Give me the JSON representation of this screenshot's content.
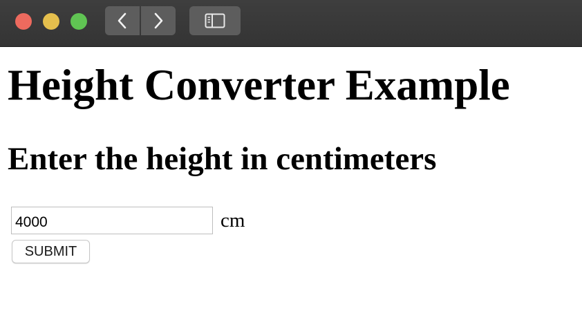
{
  "window": {
    "controls": {
      "close_color": "#ed6a5e",
      "minimize_color": "#e5bf4d",
      "zoom_color": "#60c453"
    },
    "toolbar": {
      "back_icon": "chevron-left-icon",
      "forward_icon": "chevron-right-icon",
      "sidebar_icon": "sidebar-icon"
    }
  },
  "page": {
    "title": "Height Converter Example",
    "subtitle": "Enter the height in centimeters"
  },
  "form": {
    "height_value": "4000",
    "unit_label": "cm",
    "submit_label": "SUBMIT"
  }
}
